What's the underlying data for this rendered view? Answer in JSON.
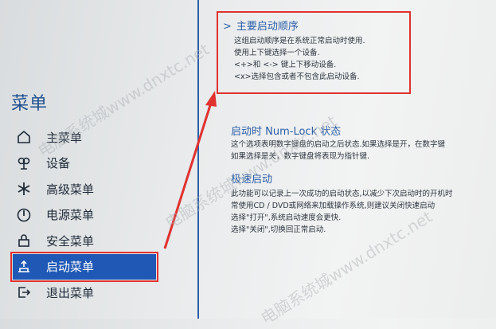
{
  "menu": {
    "title": "菜单",
    "items": [
      {
        "label": "主菜单",
        "icon": "home-icon"
      },
      {
        "label": "设备",
        "icon": "devices-icon"
      },
      {
        "label": "高级菜单",
        "icon": "asterisk-icon"
      },
      {
        "label": "电源菜单",
        "icon": "power-icon"
      },
      {
        "label": "安全菜单",
        "icon": "lock-icon"
      },
      {
        "label": "启动菜单",
        "icon": "boot-icon",
        "active": true
      },
      {
        "label": "退出菜单",
        "icon": "exit-icon"
      }
    ]
  },
  "sections": {
    "boot_order": {
      "title": "主要启动顺序",
      "lines": [
        "这组启动顺序是在系统正常启动时使用.",
        "使用上下键选择一个设备.",
        "<+>和 <-> 键上下移动设备.",
        "<x>选择包含或者不包含此启动设备."
      ]
    },
    "numlock": {
      "title": "启动时 Num-Lock 状态",
      "lines": [
        "这个选项表明数字键盘的启动之后状态.如果选择是开，在数字键",
        "如果选择是关，数字键盘将表现为指针键."
      ]
    },
    "fastboot": {
      "title": "极速启动",
      "lines": [
        "此功能可以记录上一次成功的启动状态,以减少下次启动时的开机时",
        "常使用CD / DVD或网络来加载操作系统,则建议关闭快速启动",
        "选择\"打开\",系统启动速度会更快.",
        "选择\"关闭\",切换回正常启动."
      ]
    }
  },
  "watermarks": [
    "电脑系统城www.dnxtc.net",
    "电脑系统城www.dnxtc.net",
    "电脑系统城www.dnxtc.net"
  ],
  "colors": {
    "accent": "#1f58b5",
    "highlight_border": "#e0322f",
    "title_blue": "#2a5ea8"
  }
}
